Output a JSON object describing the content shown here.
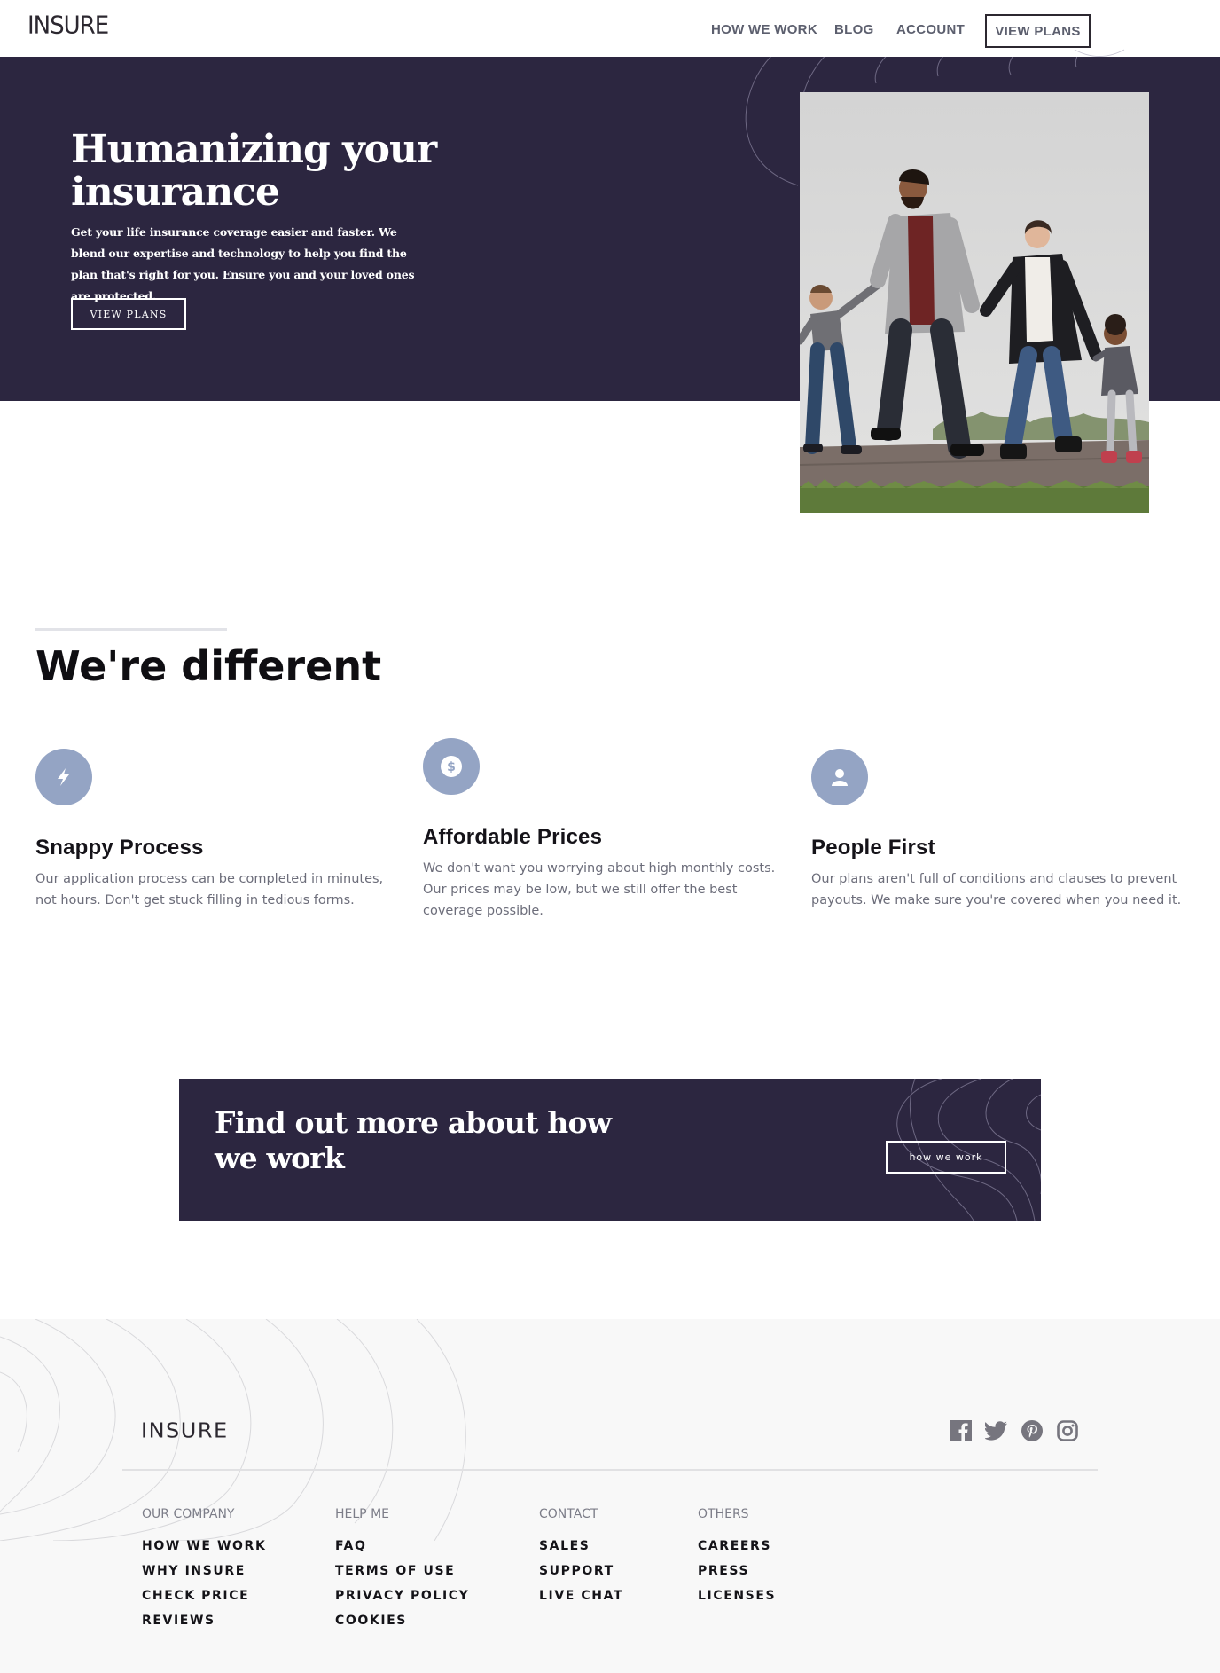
{
  "header": {
    "logo": "INSURE",
    "nav": [
      "HOW WE WORK",
      "BLOG",
      "ACCOUNT"
    ],
    "cta_label": "VIEW PLANS"
  },
  "hero": {
    "title": "Humanizing your insurance",
    "text": "Get your life insurance coverage easier and faster. We blend our expertise and technology to help you find the plan that's right for you. Ensure you and your loved ones are protected.",
    "button": "VIEW PLANS",
    "image_alt": "family-photo"
  },
  "different": {
    "title": "We're different",
    "features": [
      {
        "icon": "lightning-icon",
        "title": "Snappy Process",
        "text": "Our application process can be completed in minutes, not hours. Don't get stuck filling in tedious forms."
      },
      {
        "icon": "dollar-icon",
        "title": "Affordable Prices",
        "text": "We don't want you worrying about high monthly costs. Our prices may be low, but we still offer the best coverage possible."
      },
      {
        "icon": "person-icon",
        "title": "People First",
        "text": "Our plans aren't full of conditions and clauses to prevent payouts. We make sure you're covered when you need it."
      }
    ]
  },
  "cta": {
    "title": "Find out more about how we work",
    "button": "how we work"
  },
  "footer": {
    "logo": "INSURE",
    "social": [
      "facebook-icon",
      "twitter-icon",
      "pinterest-icon",
      "instagram-icon"
    ],
    "columns": [
      {
        "heading": "OUR COMPANY",
        "links": [
          "HOW WE WORK",
          "WHY INSURE",
          "CHECK PRICE",
          "REVIEWS"
        ]
      },
      {
        "heading": "HELP ME",
        "links": [
          "FAQ",
          "TERMS OF USE",
          "PRIVACY POLICY",
          "COOKIES"
        ]
      },
      {
        "heading": "CONTACT",
        "links": [
          "SALES",
          "SUPPORT",
          "LIVE CHAT"
        ]
      },
      {
        "heading": "OTHERS",
        "links": [
          "CAREERS",
          "PRESS",
          "LICENSES"
        ]
      }
    ]
  },
  "colors": {
    "dark_violet": "#2c2640",
    "icon_blue": "#94a4c4",
    "footer_bg": "#f8f8f8"
  }
}
